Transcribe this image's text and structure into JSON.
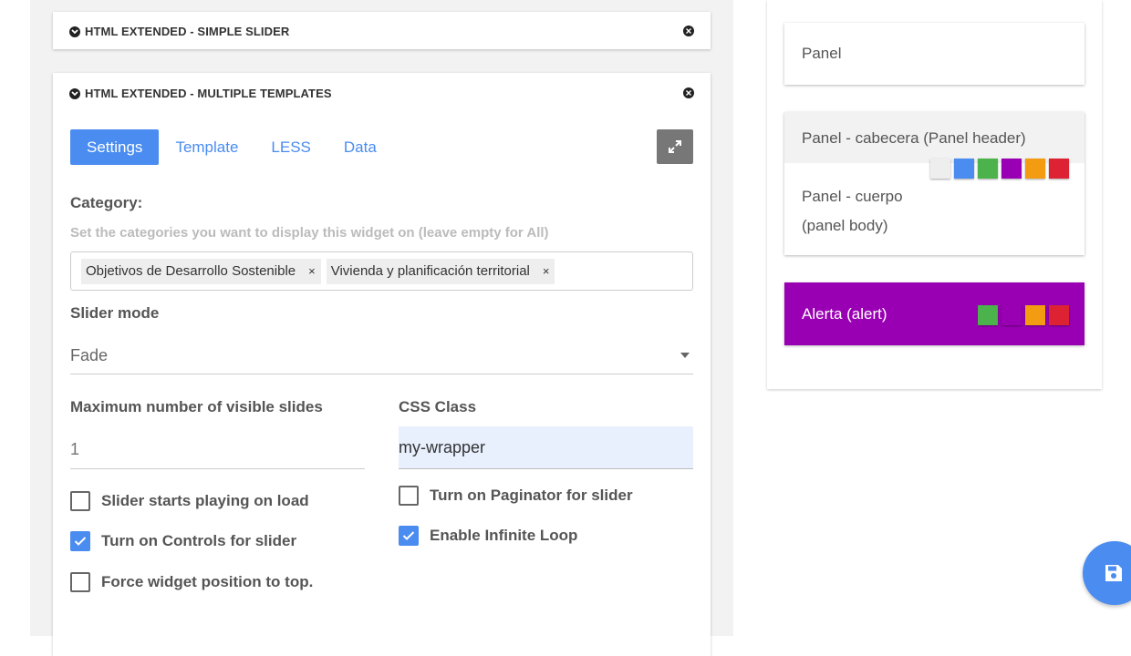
{
  "widgets": {
    "simple_slider": {
      "title": "HTML EXTENDED - SIMPLE SLIDER"
    },
    "multiple_templates": {
      "title": "HTML EXTENDED - MULTIPLE TEMPLATES"
    }
  },
  "tabs": [
    {
      "label": "Settings",
      "active": true
    },
    {
      "label": "Template",
      "active": false
    },
    {
      "label": "LESS",
      "active": false
    },
    {
      "label": "Data",
      "active": false
    }
  ],
  "category": {
    "label": "Category:",
    "hint": "Set the categories you want to display this widget on (leave empty for All)",
    "tags": [
      "Objetivos de Desarrollo Sostenible",
      "Vivienda y planificación territorial"
    ],
    "remove_glyph": "×"
  },
  "slider_mode": {
    "label": "Slider mode",
    "value": "Fade"
  },
  "max_slides": {
    "label": "Maximum number of visible slides",
    "placeholder": "1"
  },
  "css_class": {
    "label": "CSS Class",
    "value": "my-wrapper"
  },
  "checkboxes": {
    "autoplay": {
      "label": "Slider starts playing on load",
      "checked": false
    },
    "controls": {
      "label": "Turn on Controls for slider",
      "checked": true
    },
    "force_top": {
      "label": "Force widget position to top.",
      "checked": false
    },
    "paginator": {
      "label": "Turn on Paginator for slider",
      "checked": false
    },
    "infinite": {
      "label": "Enable Infinite Loop",
      "checked": true
    }
  },
  "style_panels": {
    "panel": {
      "label": "Panel"
    },
    "panel_header": {
      "label": "Panel - cabecera (Panel header)"
    },
    "panel_body": {
      "line1": "Panel - cuerpo",
      "line2": "(panel body)"
    },
    "alert": {
      "label": "Alerta (alert)"
    }
  },
  "colors": {
    "accent": "#4a8cf0",
    "alert_bg": "#9900b3",
    "swatches": [
      "#eeeeee",
      "#4a8cf0",
      "#4cb34c",
      "#9900b3",
      "#f39c12",
      "#dd2233"
    ],
    "alert_swatches": [
      "#4cb34c",
      "#9900b3",
      "#f39c12",
      "#dd2233"
    ]
  },
  "icons": {
    "collapse": "chevron-down-circle-icon",
    "close": "close-circle-icon",
    "expand": "expand-arrows-icon",
    "save": "floppy-disk-icon"
  }
}
